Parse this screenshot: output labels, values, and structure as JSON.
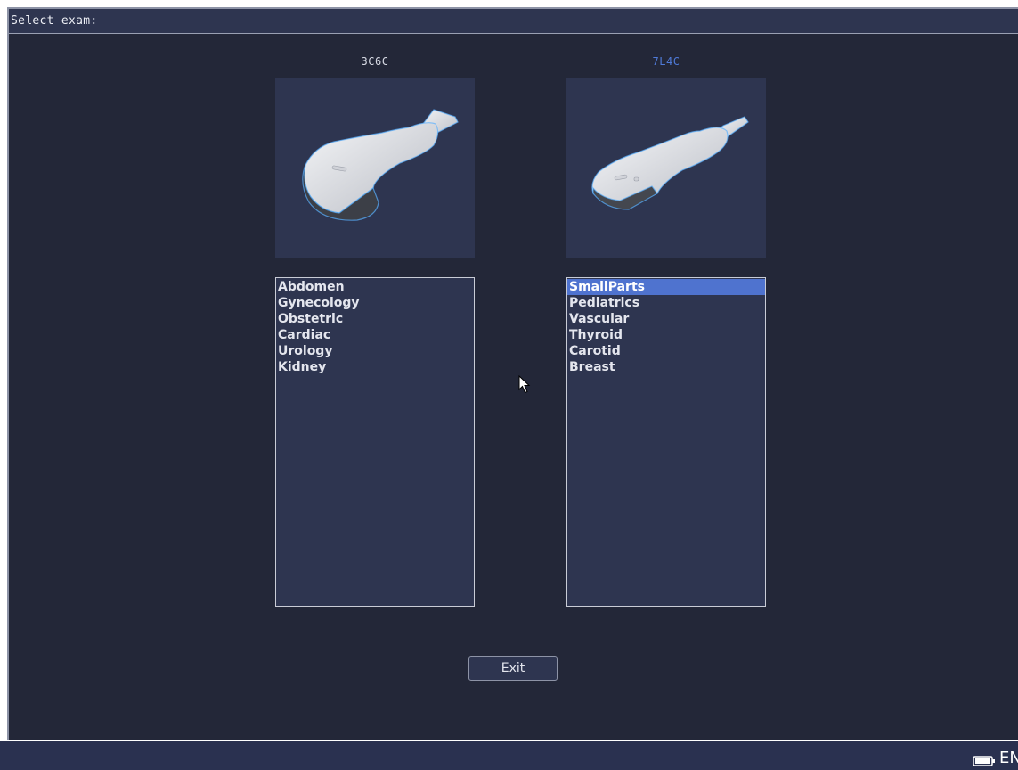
{
  "window": {
    "title": "Select exam:"
  },
  "probes": [
    {
      "name": "3C6C",
      "active": false,
      "exams": [
        "Abdomen",
        "Gynecology",
        "Obstetric",
        "Cardiac",
        "Urology",
        "Kidney"
      ],
      "selected_exam": null
    },
    {
      "name": "7L4C",
      "active": true,
      "exams": [
        "SmallParts",
        "Pediatrics",
        "Vascular",
        "Thyroid",
        "Carotid",
        "Breast"
      ],
      "selected_exam": "SmallParts"
    }
  ],
  "buttons": {
    "exit_label": "Exit"
  },
  "status_bar": {
    "language": "EN",
    "battery_icon": "battery-icon"
  },
  "colors": {
    "background": "#232738",
    "panel": "#2e3550",
    "selection": "#4f73cf",
    "active_probe_label": "#4f7ad8"
  }
}
